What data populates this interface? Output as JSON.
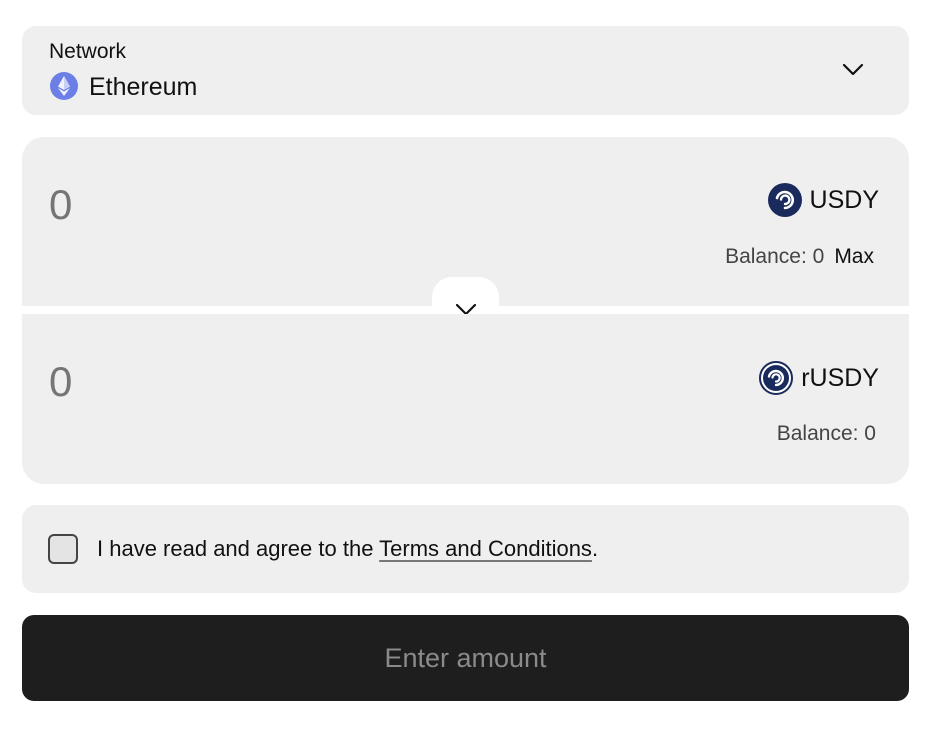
{
  "network": {
    "label": "Network",
    "value": "Ethereum",
    "icon": "ethereum-icon",
    "chevron": "chevron-down-icon"
  },
  "from": {
    "amount": "0",
    "token": "USDY",
    "token_icon": "usdy-token-icon",
    "balance_label": "Balance: 0",
    "max_label": "Max"
  },
  "to": {
    "amount": "0",
    "token": "rUSDY",
    "token_icon": "rusdy-token-icon",
    "balance_label": "Balance: 0"
  },
  "swap_icon": "chevron-down-icon",
  "terms": {
    "prefix": "I have read and agree to the ",
    "link": "Terms and Conditions",
    "suffix": ".",
    "checked": false
  },
  "action": {
    "label": "Enter amount"
  },
  "colors": {
    "panel_bg": "#efefef",
    "action_bg": "#1e1e1e",
    "placeholder": "#8a8a8a",
    "ethereum": "#6b7fe6",
    "usdy_navy": "#1b2a5c"
  }
}
